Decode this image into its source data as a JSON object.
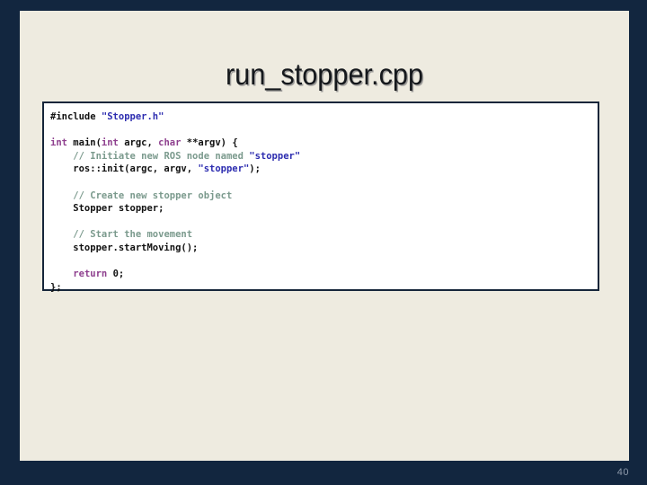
{
  "slide": {
    "title": "run_stopper.cpp",
    "page_number": "40",
    "colors": {
      "background": "#12263f",
      "panel": "#eeebe0",
      "code_background": "#ffffff",
      "code_border": "#16263a",
      "title_text": "#15181c",
      "page_number_text": "#8d99aa",
      "token_keyword": "#8e3f8e",
      "token_string": "#2d2db0",
      "token_comment": "#7b9a8d",
      "token_plain": "#111111"
    }
  },
  "code": {
    "language": "cpp",
    "lines": [
      {
        "tokens": [
          {
            "t": "#include ",
            "c": "plain"
          },
          {
            "t": "\"Stopper.h\"",
            "c": "string"
          }
        ]
      },
      {
        "tokens": [
          {
            "t": "",
            "c": "blank"
          }
        ]
      },
      {
        "tokens": [
          {
            "t": "int ",
            "c": "keyword"
          },
          {
            "t": "main(",
            "c": "plain"
          },
          {
            "t": "int ",
            "c": "keyword"
          },
          {
            "t": "argc, ",
            "c": "plain"
          },
          {
            "t": "char ",
            "c": "keyword"
          },
          {
            "t": "**argv) {",
            "c": "plain"
          }
        ]
      },
      {
        "tokens": [
          {
            "t": "    ",
            "c": "plain"
          },
          {
            "t": "// Initiate new ROS node named ",
            "c": "comment"
          },
          {
            "t": "\"stopper\"",
            "c": "string"
          }
        ]
      },
      {
        "tokens": [
          {
            "t": "    ros::init(argc, argv, ",
            "c": "plain"
          },
          {
            "t": "\"stopper\"",
            "c": "string"
          },
          {
            "t": ");",
            "c": "plain"
          }
        ]
      },
      {
        "tokens": [
          {
            "t": "",
            "c": "blank"
          }
        ]
      },
      {
        "tokens": [
          {
            "t": "    ",
            "c": "plain"
          },
          {
            "t": "// Create new stopper object",
            "c": "comment"
          }
        ]
      },
      {
        "tokens": [
          {
            "t": "    Stopper stopper;",
            "c": "plain"
          }
        ]
      },
      {
        "tokens": [
          {
            "t": "",
            "c": "blank"
          }
        ]
      },
      {
        "tokens": [
          {
            "t": "    ",
            "c": "plain"
          },
          {
            "t": "// Start the movement",
            "c": "comment"
          }
        ]
      },
      {
        "tokens": [
          {
            "t": "    stopper.startMoving();",
            "c": "plain"
          }
        ]
      },
      {
        "tokens": [
          {
            "t": "",
            "c": "blank"
          }
        ]
      },
      {
        "tokens": [
          {
            "t": "    ",
            "c": "plain"
          },
          {
            "t": "return ",
            "c": "keyword"
          },
          {
            "t": "0;",
            "c": "plain"
          }
        ]
      },
      {
        "tokens": [
          {
            "t": "};",
            "c": "plain"
          }
        ]
      }
    ]
  }
}
